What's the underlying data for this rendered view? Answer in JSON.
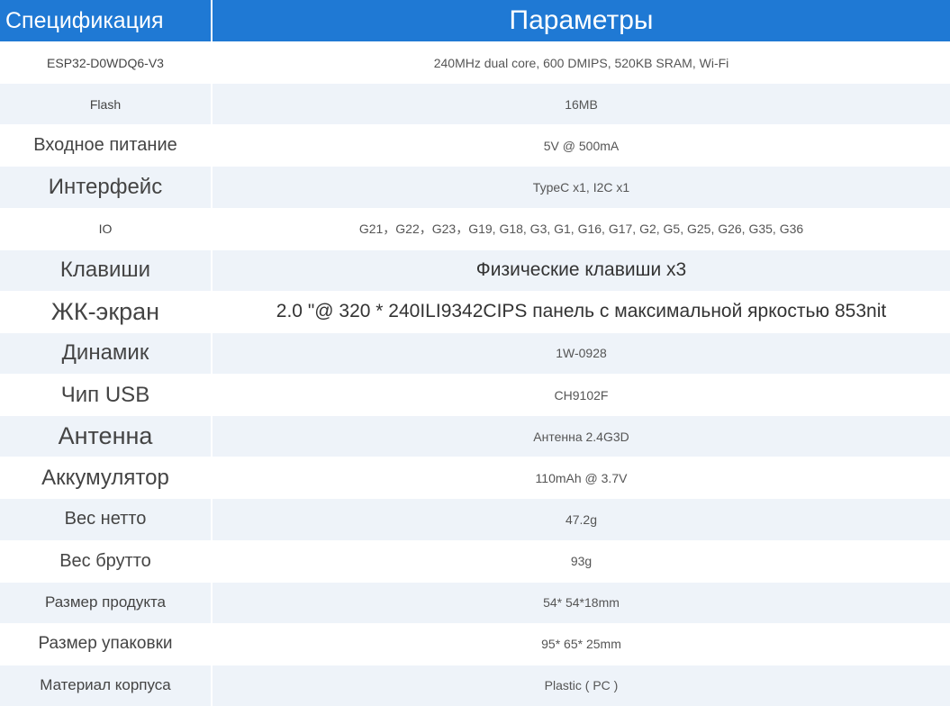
{
  "header": {
    "spec_label": "Спецификация",
    "param_label": "Параметры"
  },
  "rows": [
    {
      "spec": "ESP32-D0WDQ6-V3",
      "value": "240MHz dual core, 600 DMIPS, 520KB SRAM, Wi-Fi"
    },
    {
      "spec": "Flash",
      "value": "16MB"
    },
    {
      "spec": "Входное питание",
      "value": "5V @ 500mA"
    },
    {
      "spec": "Интерфейс",
      "value": "TypeC x1, I2C x1"
    },
    {
      "spec": "IO",
      "value": "G21，G22，G23，G19, G18, G3, G1, G16, G17, G2, G5, G25, G26, G35, G36"
    },
    {
      "spec": "Клавиши",
      "value": "Физические клавиши x3"
    },
    {
      "spec": "ЖК-экран",
      "value": "2.0 \"@ 320 * 240ILI9342CIPS панель с максимальной яркостью 853nit"
    },
    {
      "spec": "Динамик",
      "value": "1W-0928"
    },
    {
      "spec": "Чип USB",
      "value": "CH9102F"
    },
    {
      "spec": "Антенна",
      "value": "Антенна 2.4G3D"
    },
    {
      "spec": "Аккумулятор",
      "value": "110mAh @ 3.7V"
    },
    {
      "spec": "Вес нетто",
      "value": "47.2g"
    },
    {
      "spec": "Вес брутто",
      "value": "93g"
    },
    {
      "spec": "Размер продукта",
      "value": "54* 54*18mm"
    },
    {
      "spec": "Размер упаковки",
      "value": "95* 65* 25mm"
    },
    {
      "spec": "Материал корпуса",
      "value": "Plastic ( PC )"
    }
  ],
  "colors": {
    "header_bg": "#1f79d4",
    "stripe_bg": "#eef3f9"
  }
}
